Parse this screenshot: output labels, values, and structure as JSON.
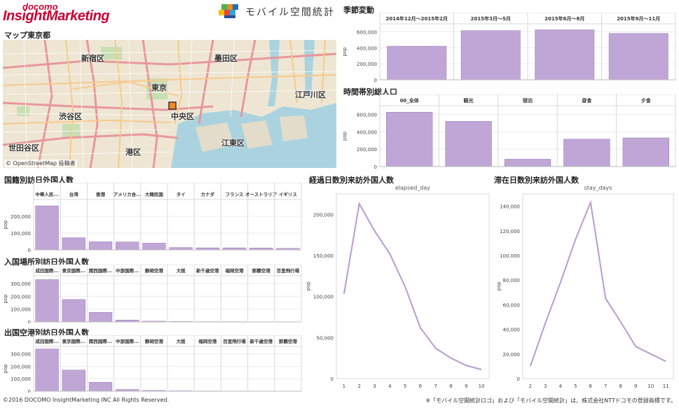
{
  "header": {
    "logo_top": "docomo",
    "logo_main": "InsightMarketing",
    "brand": "モバイル空間統計"
  },
  "map": {
    "title": "マップ東京都",
    "attribution": "© OpenStreetMap 投稿者",
    "labels": [
      "新宿区",
      "墨田区",
      "東京",
      "江戸川区",
      "渋谷区",
      "中央区",
      "江東区",
      "世田谷区",
      "港区"
    ]
  },
  "footer": {
    "copyright": "©2016 DOCOMO InsightMarketing INC All Rights Reserved.",
    "note": "※「モバイル空間統計ロゴ」および「モバイル空間統計」は、株式会社NTTドコモの登録商標です。"
  },
  "colors": {
    "bar": "#c0a6d6",
    "bar_stroke": "#9a7bb8",
    "line": "#b89bd0",
    "brand": "#cc0033"
  },
  "chart_data": [
    {
      "id": "seasonal",
      "title": "季節変動",
      "type": "bar",
      "categories": [
        "2014年12月～2015年2月",
        "2015年3月～5月",
        "2015年6月～8月",
        "2015年9月～11月"
      ],
      "values": [
        420000,
        615000,
        625000,
        580000
      ],
      "ylabel": "pop",
      "ylim": [
        0,
        700000
      ],
      "yticks": [
        0,
        200000,
        400000,
        600000
      ],
      "ytick_labels": [
        "0",
        "200,000",
        "400,000",
        "600,000"
      ]
    },
    {
      "id": "hourly",
      "title": "時間帯別総人口",
      "type": "bar",
      "categories": [
        "00_全体",
        "観光",
        "宿泊",
        "昼食",
        "夕食"
      ],
      "values": [
        625000,
        520000,
        85000,
        315000,
        330000
      ],
      "ylabel": "pop",
      "ylim": [
        0,
        700000
      ],
      "yticks": [
        0,
        200000,
        400000,
        600000
      ],
      "ytick_labels": [
        "0",
        "200,000",
        "400,000",
        "600,000"
      ]
    },
    {
      "id": "nationality",
      "title": "国籍別訪日外国人数",
      "type": "bar",
      "categories": [
        "中華人民...",
        "台湾",
        "香港",
        "アメリカ合...",
        "大韓民国",
        "タイ",
        "カナダ",
        "フランス",
        "オーストラリア",
        "イギリス"
      ],
      "values": [
        262000,
        72000,
        48000,
        47000,
        40000,
        14000,
        12000,
        12000,
        11000,
        9000
      ],
      "ylabel": "pop",
      "ylim": [
        0,
        300000
      ],
      "yticks": [
        0,
        100000,
        200000
      ],
      "ytick_labels": [
        "0",
        "100,000",
        "200,000"
      ]
    },
    {
      "id": "entry_port",
      "title": "入国場所別訪日外国人数",
      "type": "bar",
      "categories": [
        "成田国際...",
        "東京国際...",
        "関西国際...",
        "中部国際...",
        "静岡空港",
        "大阪",
        "新千歳空港",
        "福岡空港",
        "那覇空港",
        "百里飛行場"
      ],
      "values": [
        330000,
        175000,
        75000,
        15000,
        6000,
        3000,
        2000,
        2000,
        1500,
        1000
      ],
      "ylabel": "pop",
      "ylim": [
        0,
        360000
      ],
      "yticks": [
        0,
        100000,
        200000,
        300000
      ],
      "ytick_labels": [
        "0",
        "100,000",
        "200,000",
        "300,000"
      ]
    },
    {
      "id": "exit_port",
      "title": "出国空港別訪日外国人数",
      "type": "bar",
      "categories": [
        "成田国際...",
        "東京国際...",
        "関西国際...",
        "中部国際...",
        "静岡空港",
        "大阪",
        "福岡空港",
        "百里飛行場",
        "新千歳空港",
        "那覇空港"
      ],
      "values": [
        340000,
        170000,
        72000,
        14000,
        6000,
        3000,
        2000,
        1500,
        1500,
        1000
      ],
      "ylabel": "pop",
      "ylim": [
        0,
        360000
      ],
      "yticks": [
        0,
        100000,
        200000,
        300000
      ],
      "ytick_labels": [
        "0",
        "100,000",
        "200,000",
        "300,000"
      ]
    },
    {
      "id": "elapsed",
      "title": "経過日数別来訪外国人数",
      "subtitle": "elapsed_day",
      "type": "line",
      "x": [
        1,
        2,
        3,
        4,
        5,
        6,
        7,
        8,
        9,
        10
      ],
      "values": [
        103000,
        213000,
        180000,
        152000,
        112000,
        62000,
        37000,
        25000,
        16000,
        11000
      ],
      "ylabel": "pop",
      "ylim": [
        0,
        225000
      ],
      "yticks": [
        0,
        50000,
        100000,
        150000,
        200000
      ],
      "ytick_labels": [
        "0",
        "50,000",
        "100,000",
        "150,000",
        "200,000"
      ]
    },
    {
      "id": "stay",
      "title": "滞在日数別来訪外国人数",
      "subtitle": "stay_days",
      "type": "line",
      "x": [
        2,
        3,
        4,
        5,
        6,
        7,
        8,
        9,
        10,
        11
      ],
      "values": [
        10000,
        45000,
        78000,
        113000,
        143000,
        65000,
        46000,
        26000,
        20000,
        14000
      ],
      "ylabel": "pop",
      "ylim": [
        0,
        150000
      ],
      "yticks": [
        0,
        20000,
        40000,
        60000,
        80000,
        100000,
        120000,
        140000
      ],
      "ytick_labels": [
        "0",
        "20,000",
        "40,000",
        "60,000",
        "80,000",
        "100,000",
        "120,000",
        "140,000"
      ]
    }
  ]
}
